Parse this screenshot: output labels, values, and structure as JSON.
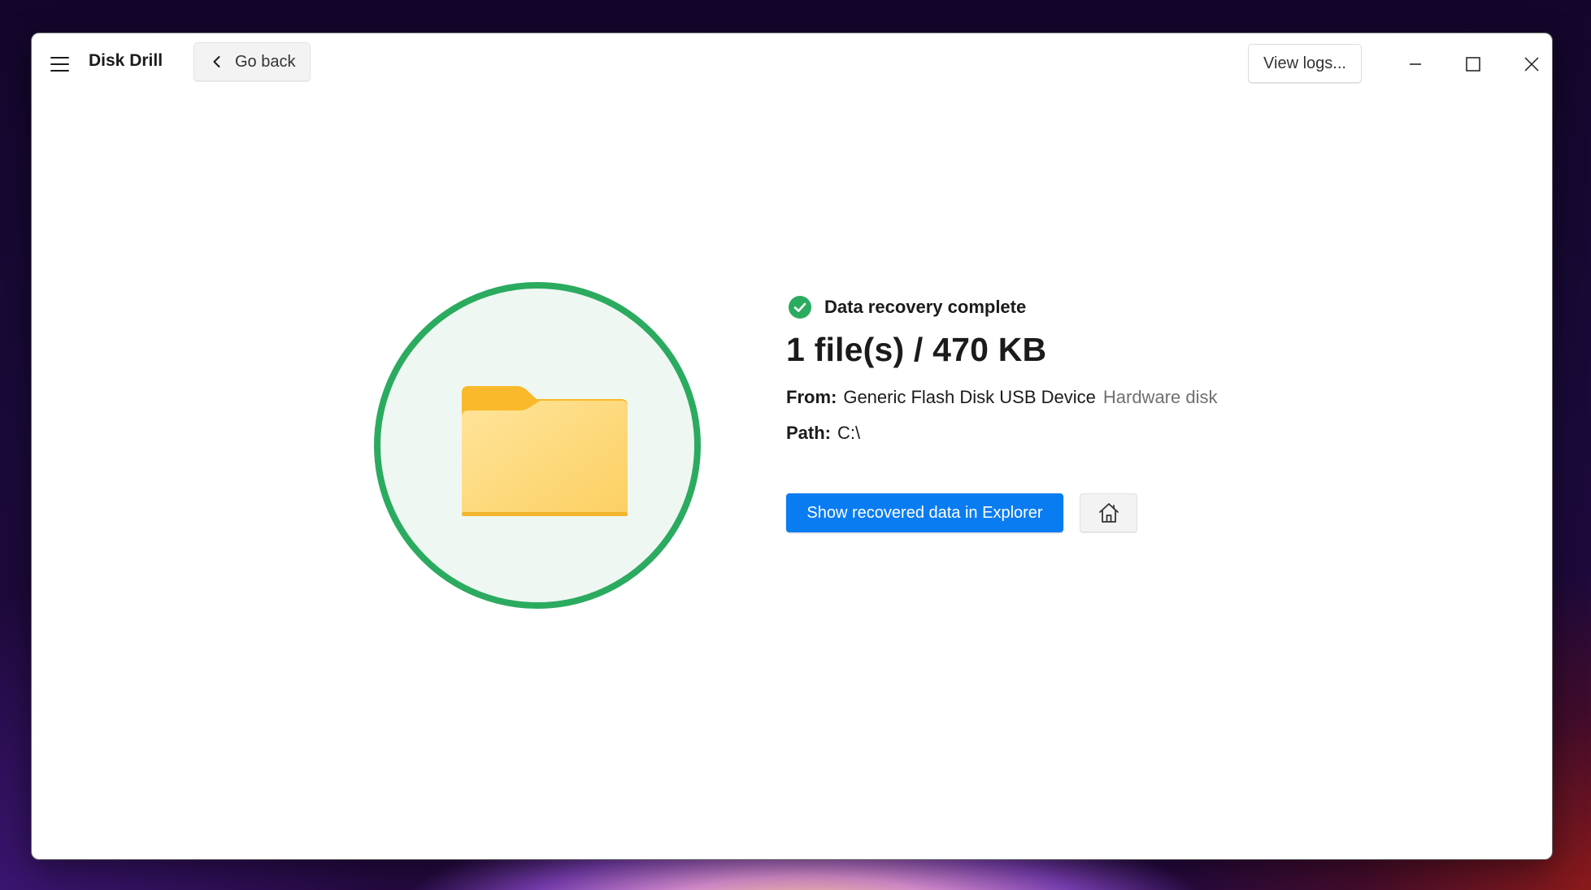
{
  "app": {
    "title": "Disk Drill"
  },
  "toolbar": {
    "go_back_label": "Go back",
    "view_logs_label": "View logs..."
  },
  "result": {
    "status": "Data recovery complete",
    "summary": "1 file(s) / 470 KB",
    "from_label": "From:",
    "from_value": "Generic Flash Disk USB Device",
    "from_type": "Hardware disk",
    "path_label": "Path:",
    "path_value": "C:\\"
  },
  "actions": {
    "show_explorer_label": "Show recovered data in Explorer"
  },
  "icons": {
    "menu": "hamburger-icon",
    "back": "chevron-left-icon",
    "minimize": "minimize-icon",
    "maximize": "maximize-icon",
    "close": "close-icon",
    "status": "check-circle-icon",
    "folder": "folder-icon",
    "home": "home-icon"
  },
  "colors": {
    "success": "#2bab5f",
    "success_bg": "#eff7f2",
    "primary": "#0a7cf2",
    "folder_front": "#fdd772",
    "folder_back": "#f9b92a"
  }
}
